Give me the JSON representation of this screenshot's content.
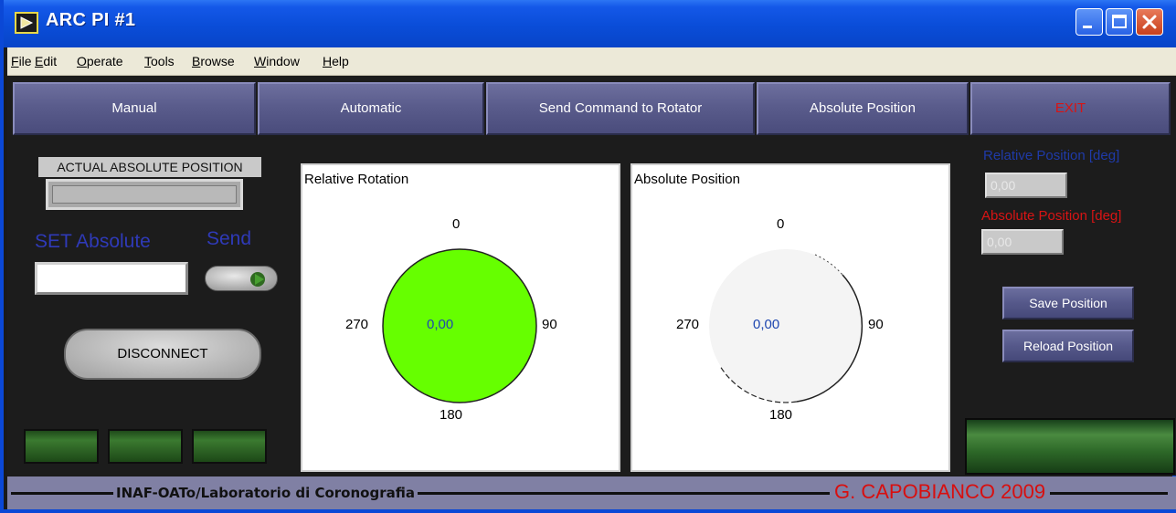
{
  "window": {
    "title": "ARC PI #1"
  },
  "menu": [
    "File",
    "Edit",
    "Operate",
    "Tools",
    "Browse",
    "Window",
    "Help"
  ],
  "nav": {
    "manual": "Manual",
    "automatic": "Automatic",
    "send_command": "Send Command to Rotator",
    "absolute_position": "Absolute Position",
    "exit": "EXIT",
    "exit_color": "#d81414"
  },
  "left": {
    "actual_label": "ACTUAL ABSOLUTE POSITION",
    "actual_value": "",
    "set_label": "SET Absolute",
    "send_label": "Send",
    "set_value": "",
    "disconnect": "DISCONNECT"
  },
  "dials": {
    "relative": {
      "title": "Relative Rotation",
      "value": "0,00",
      "fill": "#66ff00",
      "labels": {
        "top": "0",
        "right": "90",
        "bottom": "180",
        "left": "270"
      }
    },
    "absolute": {
      "title": "Absolute Position",
      "value": "0,00",
      "fill": "#f4f4f4",
      "labels": {
        "top": "0",
        "right": "90",
        "bottom": "180",
        "left": "270"
      }
    }
  },
  "right": {
    "rel_label": "Relative Position [deg]",
    "rel_value": "0,00",
    "abs_label": "Absolute Position [deg]",
    "abs_value": "0,00",
    "save": "Save Position",
    "reload": "Reload Position"
  },
  "footer": {
    "left": "INAF-OATo/Laboratorio di Coronografia",
    "right": "G. CAPOBIANCO 2009"
  }
}
